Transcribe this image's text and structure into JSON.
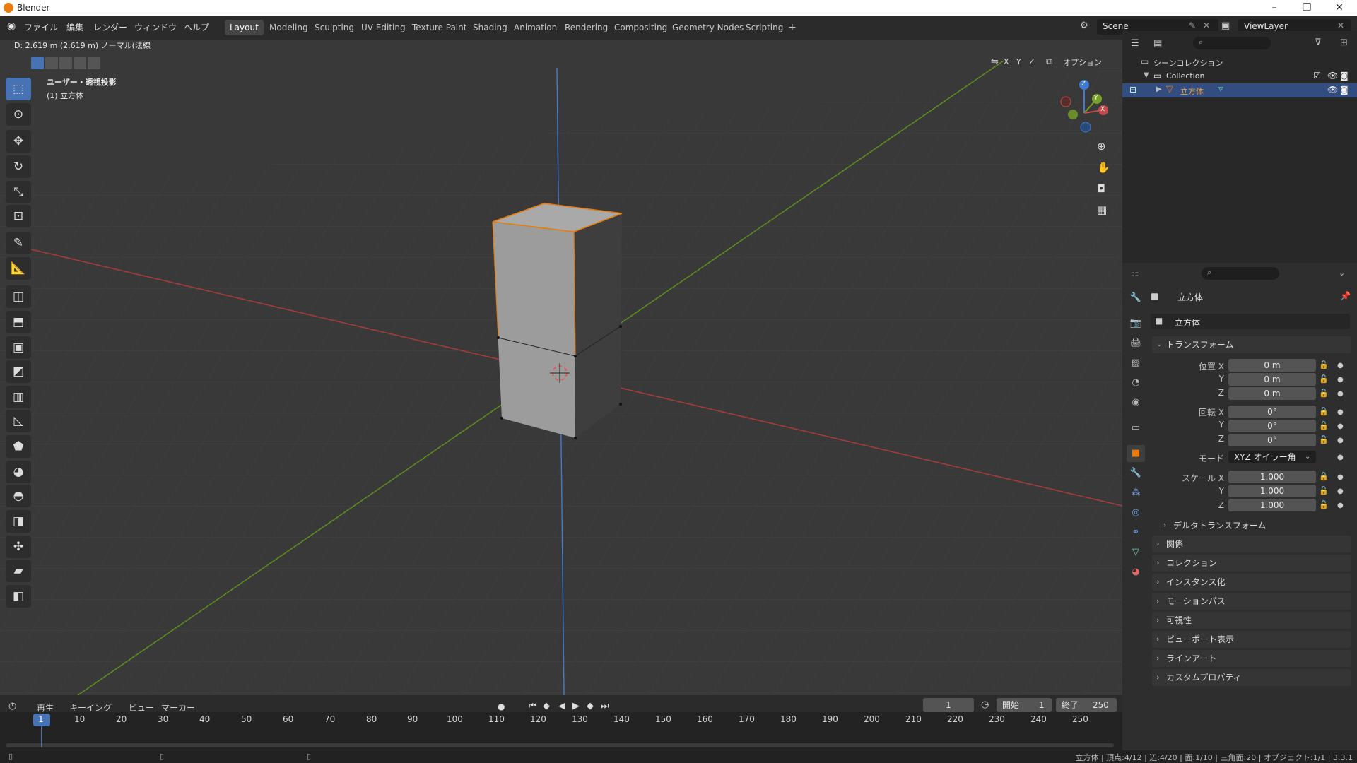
{
  "app": {
    "title": "Blender"
  },
  "menus": [
    "ファイル",
    "編集",
    "レンダー",
    "ウィンドウ",
    "ヘルプ"
  ],
  "workspaces": [
    "Layout",
    "Modeling",
    "Sculpting",
    "UV Editing",
    "Texture Paint",
    "Shading",
    "Animation",
    "Rendering",
    "Compositing",
    "Geometry Nodes",
    "Scripting"
  ],
  "workspace_add": "+",
  "scene": {
    "name": "Scene",
    "view_layer": "ViewLayer"
  },
  "viewport": {
    "info": "D: 2.619 m (2.619 m) ノーマル(法線",
    "view_name": "ユーザー・透視投影",
    "object_name": "(1) 立方体",
    "axes": [
      "X",
      "Y",
      "Z"
    ],
    "options": "オプション",
    "gizmo": {
      "x": "X",
      "y": "Y",
      "z": "Z"
    }
  },
  "outliner": {
    "scene_collection": "シーンコレクション",
    "collection": "Collection",
    "object": "立方体"
  },
  "properties": {
    "object_name": "立方体",
    "object_field": "立方体",
    "transform_title": "トランスフォーム",
    "location_label": "位置 X",
    "location": [
      "0 m",
      "0 m",
      "0 m"
    ],
    "rotation_label": "回転 X",
    "rotation": [
      "0°",
      "0°",
      "0°"
    ],
    "y_label": "Y",
    "z_label": "Z",
    "mode_label": "モード",
    "mode_value": "XYZ オイラー角",
    "scale_label": "スケール X",
    "scale": [
      "1.000",
      "1.000",
      "1.000"
    ],
    "delta_transform": "デルタトランスフォーム",
    "sections": [
      "関係",
      "コレクション",
      "インスタンス化",
      "モーションパス",
      "可視性",
      "ビューポート表示",
      "ラインアート",
      "カスタムプロパティ"
    ]
  },
  "timeline": {
    "menus": [
      "再生",
      "キーイング",
      "ビュー",
      "マーカー"
    ],
    "current_frame": "1",
    "start_label": "開始",
    "start": "1",
    "end_label": "終了",
    "end": "250",
    "ticks": [
      "1",
      "10",
      "20",
      "30",
      "40",
      "50",
      "60",
      "70",
      "80",
      "90",
      "100",
      "110",
      "120",
      "130",
      "140",
      "150",
      "160",
      "170",
      "180",
      "190",
      "200",
      "210",
      "220",
      "230",
      "240",
      "250"
    ]
  },
  "status": {
    "text": "立方体 | 頂点:4/12 | 辺:4/20 | 面:1/10 | 三角面:20 | オブジェクト:1/1 | 3.3.1"
  },
  "colors": {
    "accent": "#4772b3",
    "selection": "#e87d0d",
    "x_axis": "#c24b4b",
    "y_axis": "#77a12a",
    "z_axis": "#3f7bd4"
  }
}
